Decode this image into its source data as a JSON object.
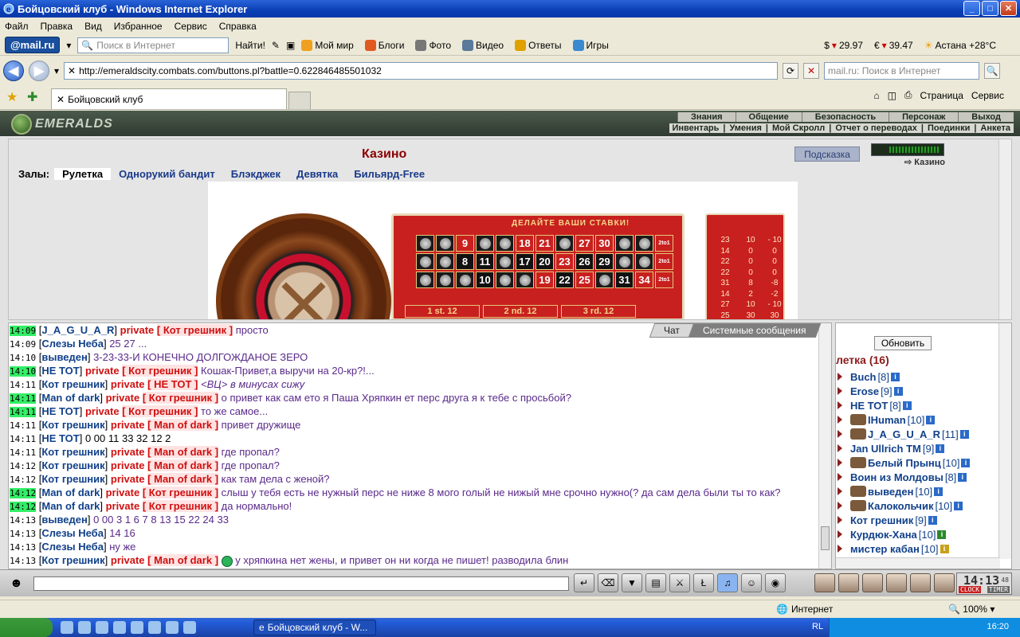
{
  "window": {
    "title": "Бойцовский клуб - Windows Internet Explorer"
  },
  "menu": [
    "Файл",
    "Правка",
    "Вид",
    "Избранное",
    "Сервис",
    "Справка"
  ],
  "mailbar": {
    "logo_text": "@mail.ru",
    "search_placeholder": "Поиск в Интернет",
    "find_label": "Найти!",
    "items": [
      "Мой мир",
      "Блоги",
      "Фото",
      "Видео",
      "Ответы",
      "Игры"
    ],
    "usd": "29.97",
    "eur": "39.47",
    "weather": "Астана +28°С"
  },
  "address": {
    "url": "http://emeraldscity.combats.com/buttons.pl?battle=0.622846485501032",
    "search_placeholder": "mail.ru: Поиск в Интернет"
  },
  "tabs": {
    "active": "Бойцовский клуб",
    "page_label": "Страница",
    "service_label": "Сервис"
  },
  "site": {
    "logo": "EMERALDS",
    "topnav": [
      "Знания",
      "Общение",
      "Безопасность",
      "Персонаж",
      "Выход"
    ],
    "subnav": [
      "Инвентарь",
      "Умения",
      "Мой Скролл",
      "Отчет о переводах",
      "Поединки",
      "Анкета"
    ]
  },
  "casino": {
    "title": "Казино",
    "hint": "Подсказка",
    "meter_label": "Казино",
    "halls_label": "Залы:",
    "halls": [
      "Рулетка",
      "Однорукий бандит",
      "Блэкджек",
      "Девятка",
      "Бильярд-Free"
    ],
    "board_title": "ДЕЛАЙТЕ ВАШИ СТАВКИ!",
    "grid": [
      [
        "c",
        "c",
        "9",
        "c",
        "c",
        "18",
        "21",
        "c",
        "27",
        "30",
        "c",
        "c"
      ],
      [
        "c",
        "c",
        "8",
        "11",
        "c",
        "17",
        "20",
        "23",
        "26",
        "29",
        "c",
        "c"
      ],
      [
        "c",
        "c",
        "c",
        "10",
        "c",
        "c",
        "19",
        "22",
        "25",
        "c",
        "31",
        "34"
      ]
    ],
    "dozens": [
      "1 st. 12",
      "2 nd. 12",
      "3 rd. 12"
    ],
    "history": [
      [
        "23",
        "10",
        "- 10"
      ],
      [
        "14",
        "0",
        "0"
      ],
      [
        "22",
        "0",
        "0"
      ],
      [
        "22",
        "0",
        "0"
      ],
      [
        "31",
        "8",
        "-8"
      ],
      [
        "14",
        "2",
        "-2"
      ],
      [
        "27",
        "10",
        "- 10"
      ],
      [
        "25",
        "30",
        "30"
      ]
    ]
  },
  "chat": {
    "tab_chat": "Чат",
    "tab_system": "Системные сообщения",
    "messages": [
      {
        "time": "14:09",
        "hl": true,
        "nick": "J_A_G_U_A_R",
        "to": "Кот грешник",
        "text": "просто"
      },
      {
        "time": "14:09",
        "hl": false,
        "nick": "Слезы Неба",
        "to": "",
        "text": "25 27 ..."
      },
      {
        "time": "14:10",
        "hl": false,
        "nick": "выведен",
        "to": "",
        "text": "3-23-33-И КОНЕЧНО ДОЛГОЖДАНОЕ ЗЕРО"
      },
      {
        "time": "14:10",
        "hl": true,
        "nick": "НЕ ТОТ",
        "to": "Кот грешник",
        "text": "Кошак-Привет,а выручи на 20-кр?!..."
      },
      {
        "time": "14:11",
        "hl": false,
        "nick": "Кот грешник",
        "to": "НЕ ТОТ",
        "text": "<ВЦ> в минусах сижу"
      },
      {
        "time": "14:11",
        "hl": true,
        "nick": "Man of dark",
        "to": "Кот грешник",
        "text": "о привет как сам ето я Паша Хряпкин ет перс друга я к тебе с просьбой?"
      },
      {
        "time": "14:11",
        "hl": true,
        "nick": "НЕ ТОТ",
        "to": "Кот грешник",
        "text": "то же самое..."
      },
      {
        "time": "14:11",
        "hl": false,
        "nick": "Кот грешник",
        "to": "Man of dark",
        "text": "привет дружище"
      },
      {
        "time": "14:11",
        "hl": false,
        "nick": "НЕ ТОТ",
        "to": "",
        "text": "0 00 11 33 32 12 2"
      },
      {
        "time": "14:11",
        "hl": false,
        "nick": "Кот грешник",
        "to": "Man of dark",
        "text": "где пропал?"
      },
      {
        "time": "14:12",
        "hl": false,
        "nick": "Кот грешник",
        "to": "Man of dark",
        "text": "где пропал?"
      },
      {
        "time": "14:12",
        "hl": false,
        "nick": "Кот грешник",
        "to": "Man of dark",
        "text": "как там дела с женой?"
      },
      {
        "time": "14:12",
        "hl": true,
        "nick": "Man of dark",
        "to": "Кот грешник",
        "text": "слыш у тебя есть не нужный перс не ниже 8 мого голый не нижый мне срочно нужно(? да сам дела были ты то как?"
      },
      {
        "time": "14:12",
        "hl": true,
        "nick": "Man of dark",
        "to": "Кот грешник",
        "text": "да нормально!"
      },
      {
        "time": "14:13",
        "hl": false,
        "nick": "выведен",
        "to": "",
        "text": "0 00 3 1 6 7 8 13 15 22 24 33"
      },
      {
        "time": "14:13",
        "hl": false,
        "nick": "Слезы Неба",
        "to": "",
        "text": "14 16"
      },
      {
        "time": "14:13",
        "hl": false,
        "nick": "Слезы Неба",
        "to": "",
        "text": "ну же"
      },
      {
        "time": "14:13",
        "hl": false,
        "nick": "Кот грешник",
        "to": "Man of dark",
        "text": "у хряпкина нет жены, и привет он ни когда не пишет! разводила блин"
      }
    ]
  },
  "users": {
    "refresh": "Обновить",
    "room": "летка (16)",
    "list": [
      {
        "name": "Buch",
        "lvl": "[8]",
        "av": false
      },
      {
        "name": "Erose",
        "lvl": "[9]",
        "av": false
      },
      {
        "name": "НЕ ТОТ",
        "lvl": "[8]",
        "av": false
      },
      {
        "name": "IHuman",
        "lvl": "[10]",
        "av": true
      },
      {
        "name": "J_A_G_U_A_R",
        "lvl": "[11]",
        "av": true
      },
      {
        "name": "Jan Ullrich TM",
        "lvl": "[9]",
        "av": false
      },
      {
        "name": "Белый Прынц",
        "lvl": "[10]",
        "av": true
      },
      {
        "name": "Воин из Молдовы",
        "lvl": "[8]",
        "av": false
      },
      {
        "name": "выведен",
        "lvl": "[10]",
        "av": true
      },
      {
        "name": "Калокольчик",
        "lvl": "[10]",
        "av": true
      },
      {
        "name": "Кот грешник",
        "lvl": "[9]",
        "av": false
      },
      {
        "name": "Курдюк-Хана",
        "lvl": "[10]",
        "av": false
      },
      {
        "name": "мистер кабан",
        "lvl": "[10]",
        "av": false
      }
    ]
  },
  "clock": {
    "time": "14:13",
    "sec": "48",
    "clock_label": "CLOCK",
    "timer_label": "TIMER"
  },
  "status": {
    "zone": "Интернет",
    "zoom": "100%"
  },
  "taskbar": {
    "window": "Бойцовский клуб - W...",
    "lang": "RL",
    "time": "16:20"
  }
}
